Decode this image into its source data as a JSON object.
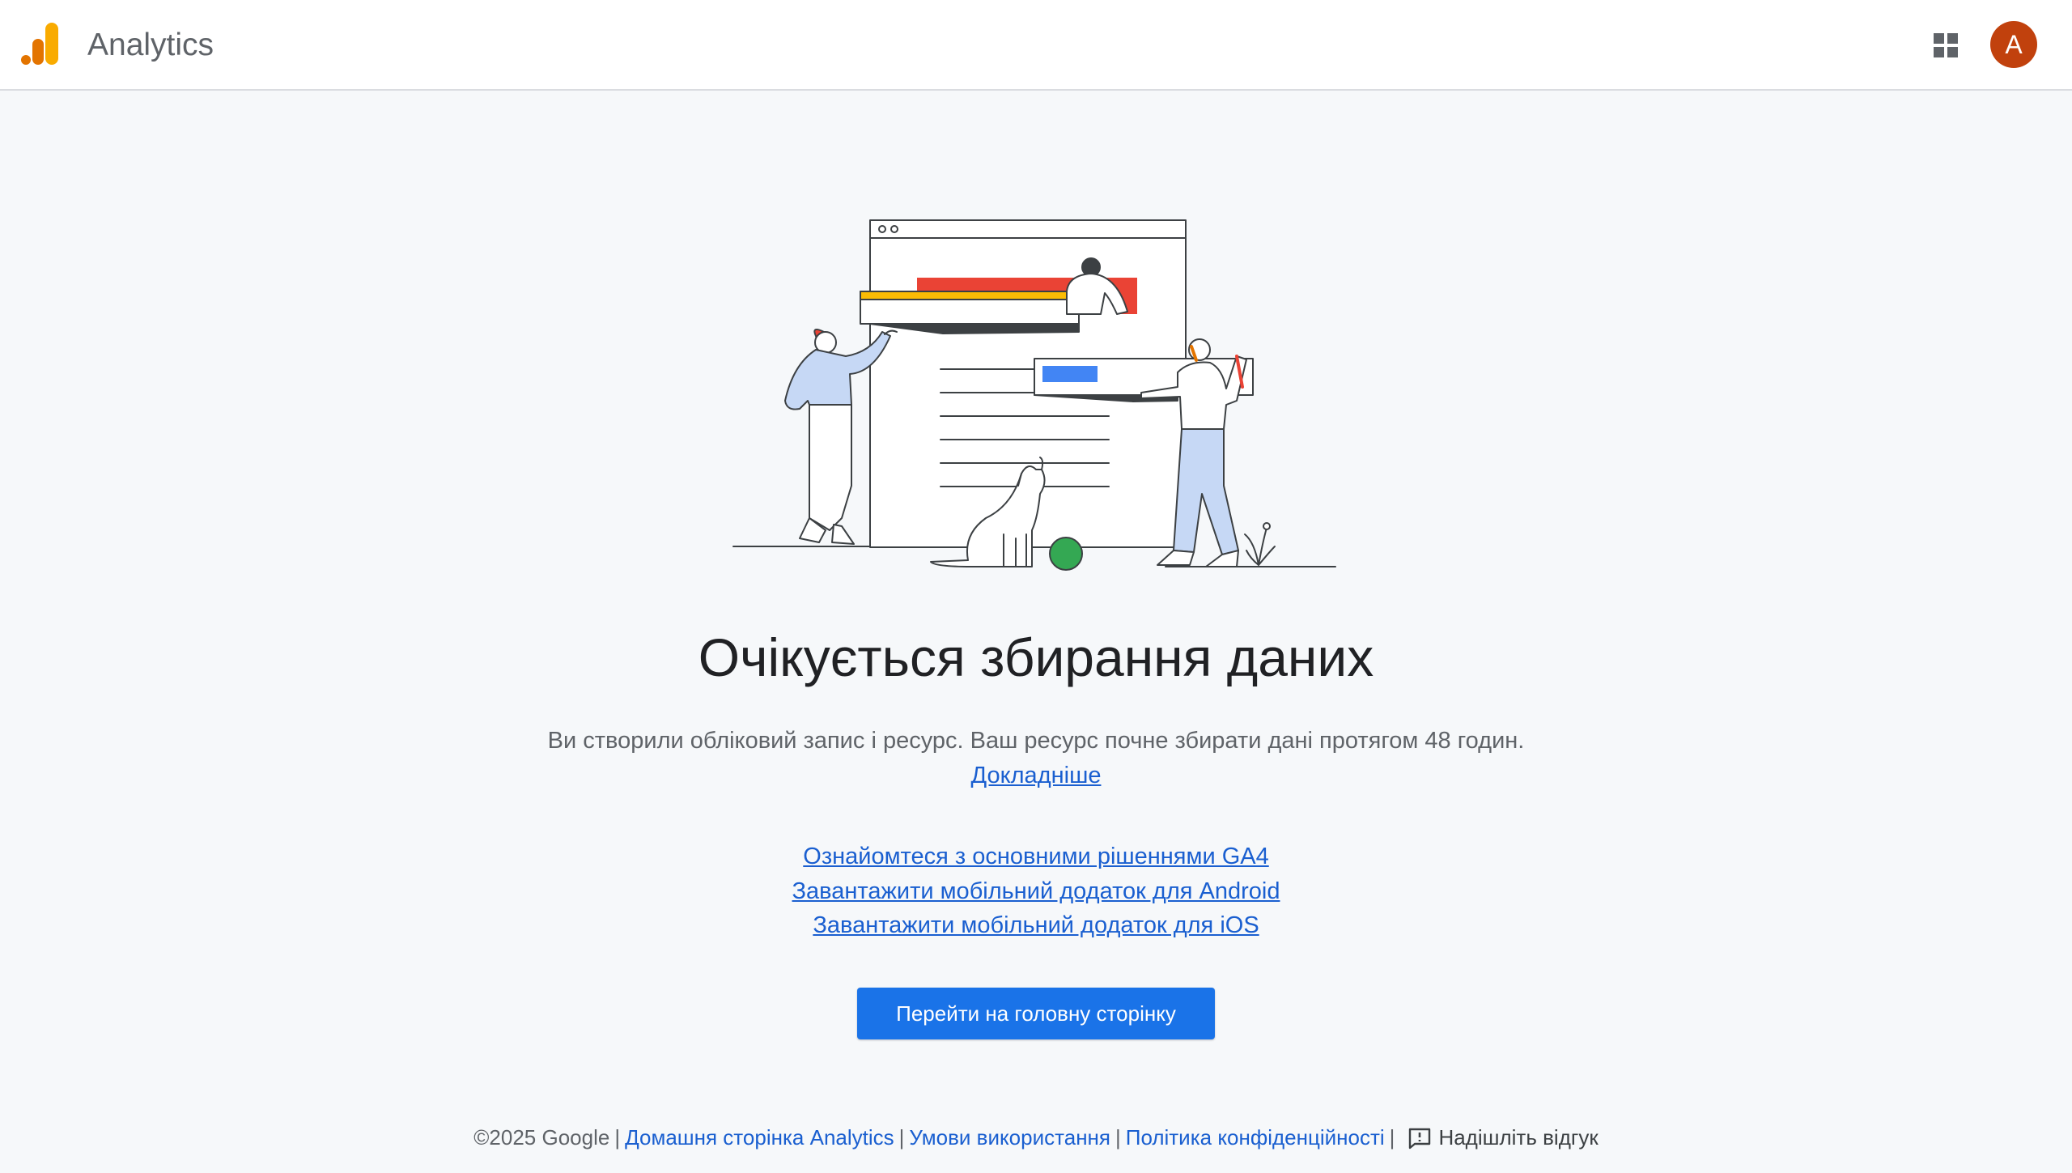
{
  "header": {
    "app_name": "Analytics",
    "logo_icon": "analytics-bars-logo",
    "apps_icon": "apps-grid-icon",
    "avatar_letter": "A",
    "avatar_color": "#c1410d"
  },
  "main": {
    "headline": "Очікується збирання даних",
    "description": "Ви створили обліковий запис і ресурс. Ваш ресурс почне збирати дані протягом 48 годин.",
    "learn_more": "Докладніше",
    "links": [
      "Ознайомтеся з основними рішеннями GA4",
      "Завантажити мобільний додаток для Android",
      "Завантажити мобільний додаток для iOS"
    ],
    "cta_label": "Перейти на головну сторінку"
  },
  "footer": {
    "copyright": "©2025 Google",
    "home_link": "Домашня сторінка Analytics",
    "terms_link": "Умови використання",
    "privacy_link": "Політика конфіденційності",
    "feedback_label": "Надішліть відгук",
    "feedback_icon": "feedback-icon"
  },
  "colors": {
    "accent_blue": "#1a73e8",
    "link_blue": "#1a5fd0",
    "logo_orange": "#f9ab00",
    "logo_dark_orange": "#e37400",
    "illustration_red": "#ea4335",
    "illustration_yellow": "#fbbc04",
    "illustration_blue": "#4285f4",
    "illustration_green": "#34a853",
    "background": "#f6f8fa"
  }
}
